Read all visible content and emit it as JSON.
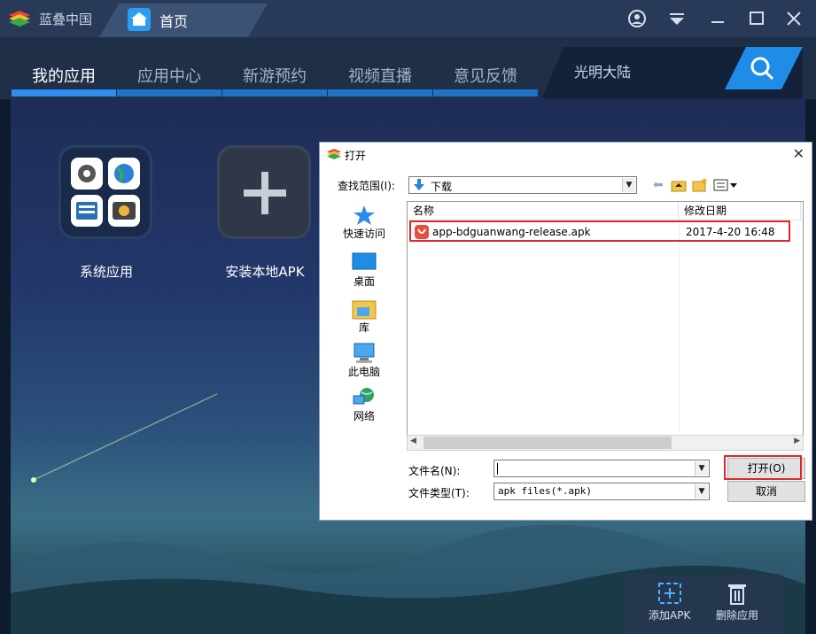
{
  "app": {
    "name": "蓝叠中国",
    "tab_label": "首页"
  },
  "nav": {
    "items": [
      "我的应用",
      "应用中心",
      "新游预约",
      "视频直播",
      "意见反馈"
    ],
    "search_value": "光明大陆"
  },
  "apps": [
    {
      "label": "系统应用"
    },
    {
      "label": "安装本地APK"
    }
  ],
  "bottom_bar": {
    "add_label": "添加APK",
    "delete_label": "删除应用"
  },
  "dialog": {
    "title": "打开",
    "look_in_label": "查找范围(I):",
    "look_in_value": "下载",
    "places": [
      "快速访问",
      "桌面",
      "库",
      "此电脑",
      "网络"
    ],
    "columns": [
      "名称",
      "修改日期"
    ],
    "files": [
      {
        "name": "app-bdguanwang-release.apk",
        "modified": "2017-4-20 16:48"
      }
    ],
    "filename_label": "文件名(N):",
    "filename_value": "",
    "filetype_label": "文件类型(T):",
    "filetype_value": "apk files(*.apk)",
    "open_button": "打开(O)",
    "cancel_button": "取消"
  },
  "colors": {
    "accent": "#1f8de8",
    "highlight": "#e0262b",
    "titlebar": "#283a57"
  }
}
